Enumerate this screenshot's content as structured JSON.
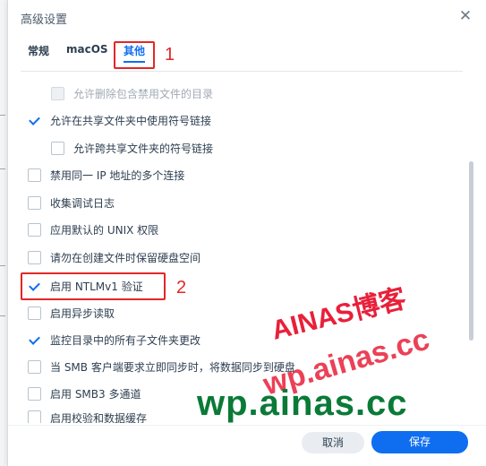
{
  "dialog": {
    "title": "高级设置",
    "close_icon": "close-icon"
  },
  "tabs": [
    {
      "label": "常规",
      "active": false
    },
    {
      "label": "macOS",
      "active": false
    },
    {
      "label": "其他",
      "active": true
    }
  ],
  "options": [
    {
      "label": "允许删除包含禁用文件的目录",
      "checked": false,
      "disabled": true
    },
    {
      "label": "允许在共享文件夹中使用符号链接",
      "checked": true,
      "disabled": false
    },
    {
      "label": "允许跨共享文件夹的符号链接",
      "checked": false,
      "disabled": false
    },
    {
      "label": "禁用同一 IP 地址的多个连接",
      "checked": false,
      "disabled": false
    },
    {
      "label": "收集调试日志",
      "checked": false,
      "disabled": false
    },
    {
      "label": "应用默认的 UNIX 权限",
      "checked": false,
      "disabled": false
    },
    {
      "label": "请勿在创建文件时保留硬盘空间",
      "checked": false,
      "disabled": false
    },
    {
      "label": "启用 NTLMv1 验证",
      "checked": true,
      "disabled": false
    },
    {
      "label": "启用异步读取",
      "checked": false,
      "disabled": false
    },
    {
      "label": "监控目录中的所有子文件夹更改",
      "checked": true,
      "disabled": false
    },
    {
      "label": "当 SMB 客户端要求立即同步时，将数据同步到硬盘",
      "checked": false,
      "disabled": false
    },
    {
      "label": "启用 SMB3 多通道",
      "checked": false,
      "disabled": false
    },
    {
      "label": "启用校验和数据缓存",
      "checked": false,
      "disabled": false
    }
  ],
  "annotations": [
    "1",
    "2"
  ],
  "footer": {
    "cancel_label": "取消",
    "save_label": "保存"
  },
  "watermarks": {
    "brand": "AINAS博客",
    "domain_red": "wp.ainas.cc",
    "domain_green": "wp.ainas.cc"
  },
  "colors": {
    "accent": "#0f6ef0",
    "annotation": "#e22727",
    "watermark_red": "#e8203a",
    "watermark_green": "#0a7a37"
  }
}
